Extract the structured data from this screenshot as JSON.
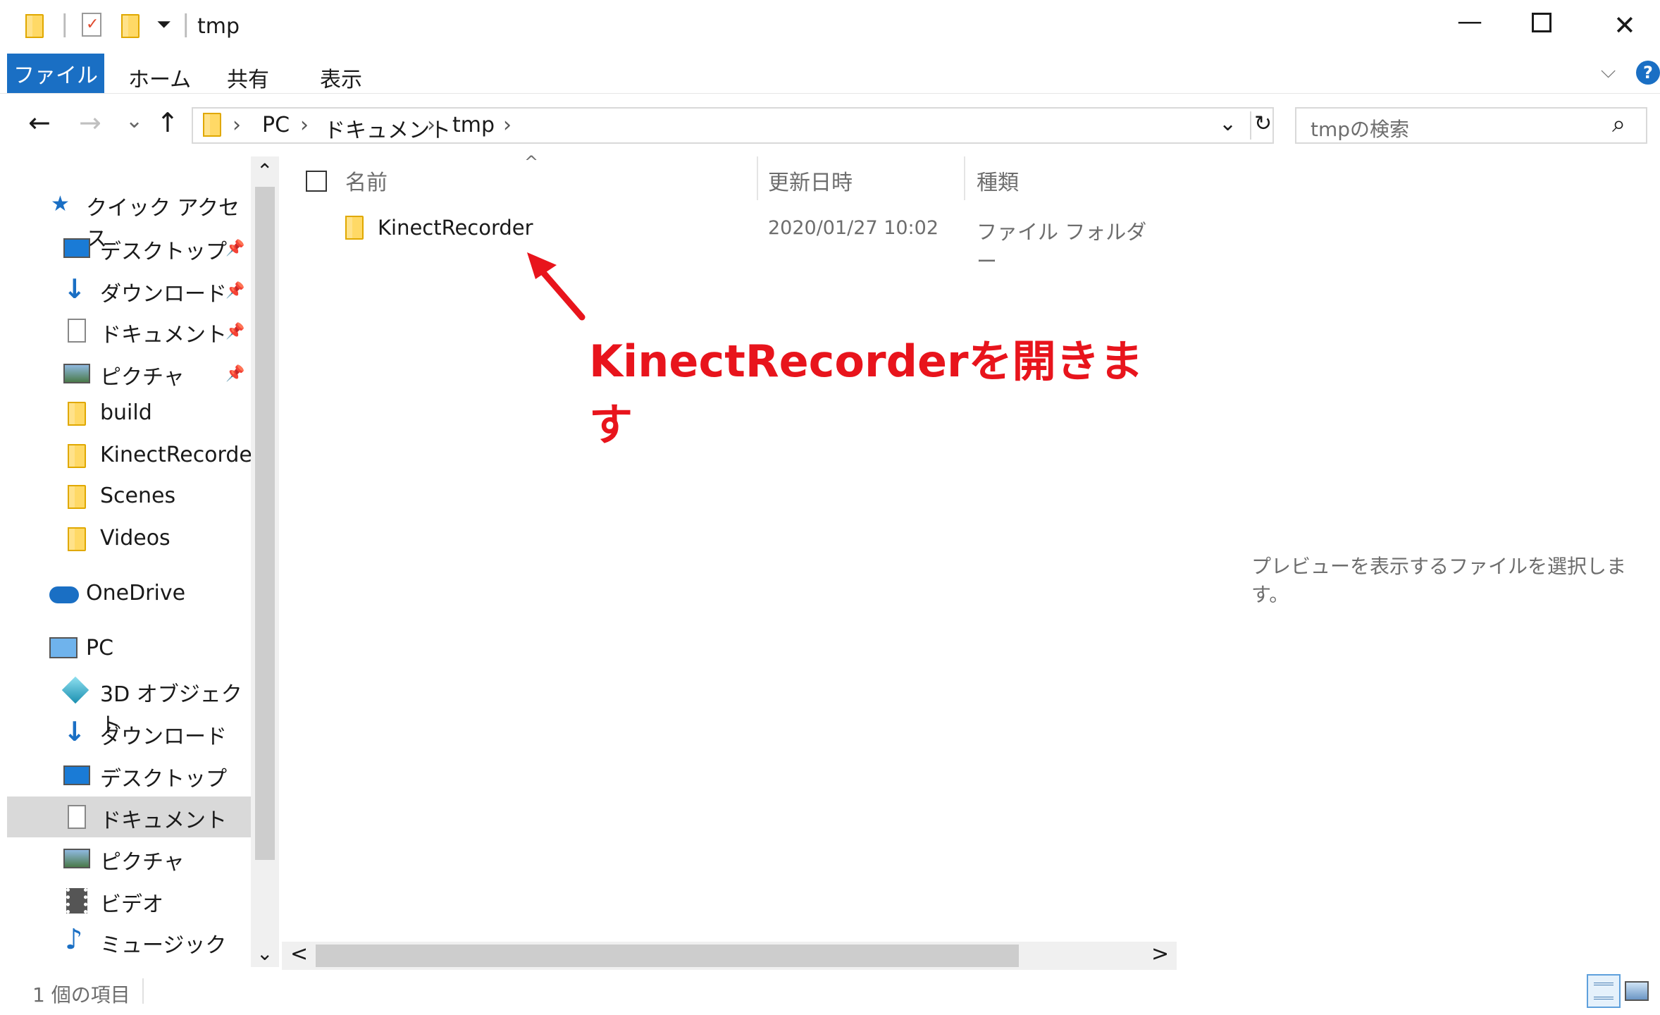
{
  "window": {
    "title": "tmp",
    "min_symbol": "—",
    "max_symbol": "☐",
    "close_symbol": "✕"
  },
  "ribbon": {
    "tabs": [
      "ファイル",
      "ホーム",
      "共有",
      "表示"
    ],
    "help_symbol": "?",
    "expand_symbol": "⌵"
  },
  "address": {
    "back": "←",
    "forward": "→",
    "recent": "⌄",
    "up": "↑",
    "crumbs": [
      "PC",
      "ドキュメント",
      "tmp"
    ],
    "separator": "›",
    "dropdown": "⌄",
    "refresh": "↻"
  },
  "search": {
    "placeholder": "tmpの検索",
    "icon": "⌕"
  },
  "nav": {
    "quick_access": "クイック アクセス",
    "quick_items": [
      {
        "label": "デスクトップ",
        "icon": "desktop-icon",
        "pinned": true
      },
      {
        "label": "ダウンロード",
        "icon": "download-icon",
        "pinned": true
      },
      {
        "label": "ドキュメント",
        "icon": "document-icon",
        "pinned": true
      },
      {
        "label": "ピクチャ",
        "icon": "picture-icon",
        "pinned": true
      },
      {
        "label": "build",
        "icon": "folder-icon",
        "pinned": false
      },
      {
        "label": "KinectRecorder",
        "icon": "folder-icon",
        "pinned": false
      },
      {
        "label": "Scenes",
        "icon": "folder-icon",
        "pinned": false
      },
      {
        "label": "Videos",
        "icon": "folder-icon",
        "pinned": false
      }
    ],
    "onedrive": "OneDrive",
    "pc": "PC",
    "pc_items": [
      {
        "label": "3D オブジェクト",
        "icon": "3d-objects-icon"
      },
      {
        "label": "ダウンロード",
        "icon": "download-icon"
      },
      {
        "label": "デスクトップ",
        "icon": "desktop-icon"
      },
      {
        "label": "ドキュメント",
        "icon": "document-icon",
        "selected": true
      },
      {
        "label": "ピクチャ",
        "icon": "picture-icon"
      },
      {
        "label": "ビデオ",
        "icon": "video-icon"
      },
      {
        "label": "ミュージック",
        "icon": "music-icon"
      }
    ],
    "scroll_up": "⌃",
    "scroll_down": "⌄"
  },
  "files": {
    "columns": {
      "name": "名前",
      "modified": "更新日時",
      "type": "種類"
    },
    "sort_indicator": "^",
    "rows": [
      {
        "name": "KinectRecorder",
        "modified": "2020/01/27 10:02",
        "type": "ファイル フォルダー"
      }
    ],
    "scroll_left": "<",
    "scroll_right": ">"
  },
  "annotation": {
    "text": "KinectRecorderを開きます",
    "color": "#e8141c"
  },
  "preview": {
    "message": "プレビューを表示するファイルを選択します。"
  },
  "status": {
    "count": "1 個の項目"
  },
  "colors": {
    "accent": "#1a6fc4",
    "selected": "#cce8ff",
    "folder": "#ffd966"
  }
}
